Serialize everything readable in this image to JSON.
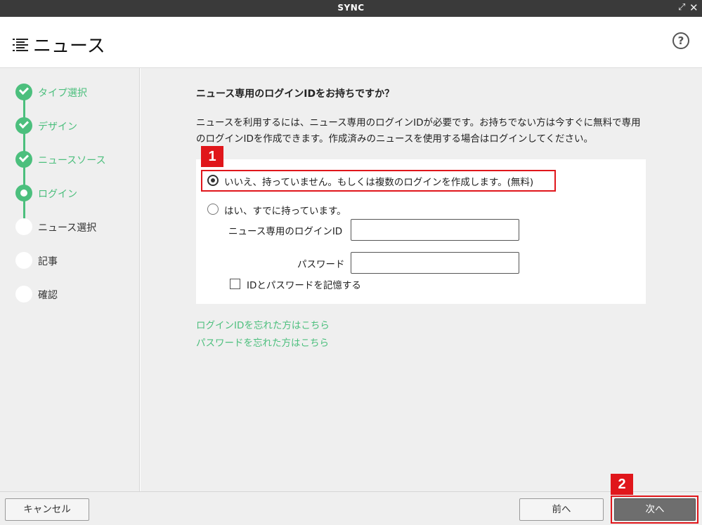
{
  "window": {
    "title": "SYNC"
  },
  "header": {
    "title": "ニュース"
  },
  "steps": [
    {
      "label": "タイプ選択",
      "state": "done"
    },
    {
      "label": "デザイン",
      "state": "done"
    },
    {
      "label": "ニュースソース",
      "state": "done"
    },
    {
      "label": "ログイン",
      "state": "current"
    },
    {
      "label": "ニュース選択",
      "state": "pending"
    },
    {
      "label": "記事",
      "state": "pending"
    },
    {
      "label": "確認",
      "state": "pending"
    }
  ],
  "main": {
    "question": "ニュース専用のログインIDをお持ちですか？",
    "description": "ニュースを利用するには、ニュース専用のログインIDが必要です。お持ちでない方は今すぐに無料で専用のログインIDを作成できます。作成済みのニュースを使用する場合はログインしてください。",
    "option_no": "いいえ、持っていません。もしくは複数のログインを作成します。(無料)",
    "option_yes": "はい、すでに持っています。",
    "login_id_label": "ニュース専用のログインID",
    "password_label": "パスワード",
    "login_id_value": "",
    "password_value": "",
    "remember_label": "IDとパスワードを記憶する",
    "forgot_id_link": "ログインIDを忘れた方はこちら",
    "forgot_password_link": "パスワードを忘れた方はこちら"
  },
  "annotations": {
    "badge1": "1",
    "badge2": "2"
  },
  "footer": {
    "cancel": "キャンセル",
    "prev": "前へ",
    "next": "次へ"
  },
  "colors": {
    "accent": "#4cbf7d",
    "highlight": "#e0161b",
    "titlebar": "#3a3a3a"
  }
}
